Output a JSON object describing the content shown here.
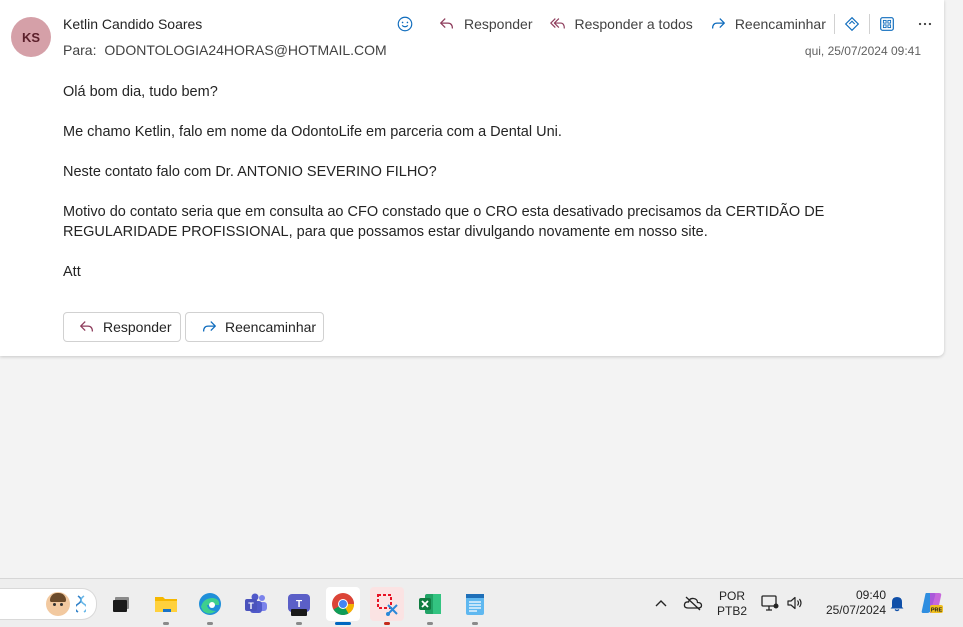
{
  "email": {
    "avatar_initials": "KS",
    "sender_name": "Ketlin Candido Soares",
    "to_label": "Para:",
    "to_value": "ODONTOLOGIA24HORAS@HOTMAIL.COM",
    "date": "qui, 25/07/2024 09:41",
    "body": [
      "Olá bom dia, tudo bem?",
      "Me chamo Ketlin, falo em nome da OdontoLife em parceria com a Dental Uni.",
      "Neste contato falo com Dr.  ANTONIO SEVERINO FILHO?",
      "Motivo do contato seria que em consulta ao CFO constado que o CRO esta desativado precisamos da CERTIDÃO DE REGULARIDADE PROFISSIONAL, para que possamos estar divulgando novamente em nosso site.",
      "Att"
    ]
  },
  "toolbar": {
    "reply_label": "Responder",
    "reply_all_label": "Responder a todos",
    "forward_label": "Reencaminhar"
  },
  "actions": {
    "reply_label": "Responder",
    "forward_label": "Reencaminhar"
  },
  "taskbar": {
    "language_line1": "POR",
    "language_line2": "PTB2",
    "time": "09:40",
    "date": "25/07/2024"
  },
  "colors": {
    "accent": "#0f6cbd",
    "avatar_bg": "#d5a0a8",
    "taskbar_bg": "#eeeeee"
  }
}
